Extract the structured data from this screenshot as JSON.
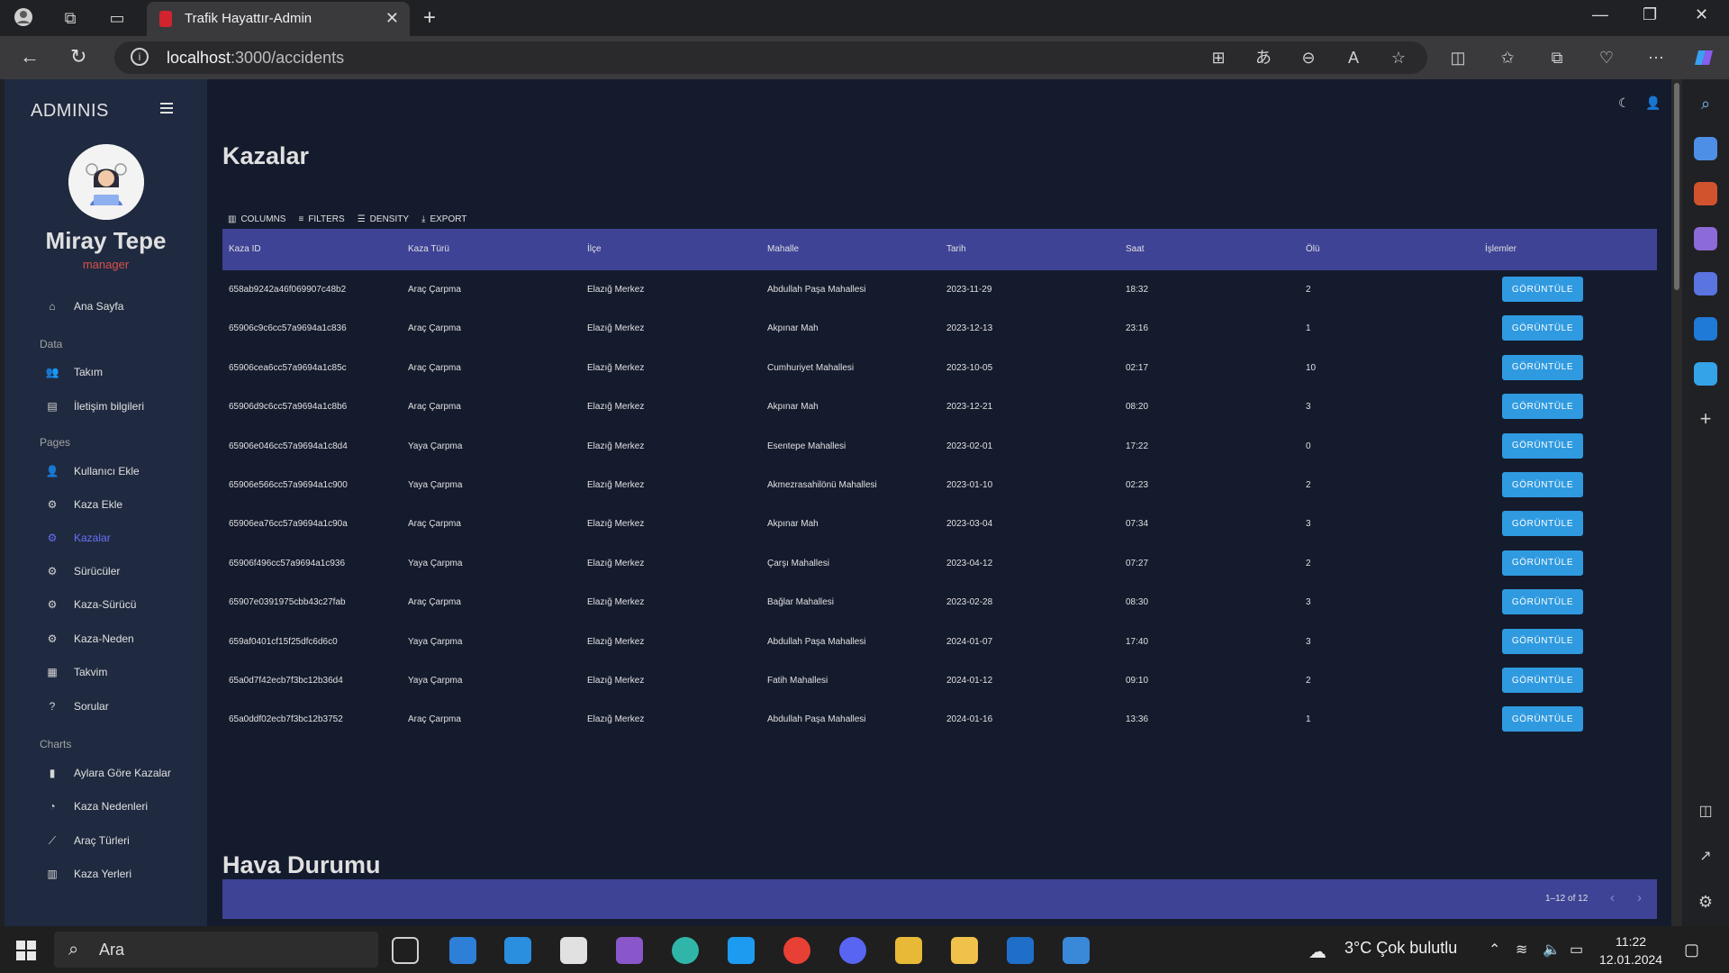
{
  "browser": {
    "tab_title": "Trafik Hayattır-Admin",
    "url_host": "localhost",
    "url_path": ":3000/accidents"
  },
  "sidebar": {
    "brand": "ADMINIS",
    "user_name": "Miray Tepe",
    "user_role": "manager",
    "home": "Ana Sayfa",
    "section_data": "Data",
    "data_items": [
      "Takım",
      "İletişim bilgileri"
    ],
    "section_pages": "Pages",
    "page_items": [
      "Kullanıcı Ekle",
      "Kaza Ekle",
      "Kazalar",
      "Sürücüler",
      "Kaza-Sürücü",
      "Kaza-Neden",
      "Takvim",
      "Sorular"
    ],
    "section_charts": "Charts",
    "chart_items": [
      "Aylara Göre Kazalar",
      "Kaza Nedenleri",
      "Araç Türleri",
      "Kaza Yerleri"
    ],
    "active_item": "Kazalar"
  },
  "main": {
    "title": "Kazalar",
    "toolbar": {
      "columns": "COLUMNS",
      "filters": "FILTERS",
      "density": "DENSITY",
      "export": "EXPORT"
    },
    "columns": [
      "Kaza ID",
      "Kaza Türü",
      "İlçe",
      "Mahalle",
      "Tarih",
      "Saat",
      "Ölü",
      "İşlemler"
    ],
    "action_label": "GÖRÜNTÜLE",
    "rows": [
      [
        "658ab9242a46f069907c48b2",
        "Araç Çarpma",
        "Elazığ Merkez",
        "Abdullah Paşa Mahallesi",
        "2023-11-29",
        "18:32",
        "2"
      ],
      [
        "65906c9c6cc57a9694a1c836",
        "Araç Çarpma",
        "Elazığ Merkez",
        "Akpınar Mah",
        "2023-12-13",
        "23:16",
        "1"
      ],
      [
        "65906cea6cc57a9694a1c85c",
        "Araç Çarpma",
        "Elazığ Merkez",
        "Cumhuriyet Mahallesi",
        "2023-10-05",
        "02:17",
        "10"
      ],
      [
        "65906d9c6cc57a9694a1c8b6",
        "Araç Çarpma",
        "Elazığ Merkez",
        "Akpınar Mah",
        "2023-12-21",
        "08:20",
        "3"
      ],
      [
        "65906e046cc57a9694a1c8d4",
        "Yaya Çarpma",
        "Elazığ Merkez",
        "Esentepe Mahallesi",
        "2023-02-01",
        "17:22",
        "0"
      ],
      [
        "65906e566cc57a9694a1c900",
        "Yaya Çarpma",
        "Elazığ Merkez",
        "Akmezrasahilönü Mahallesi",
        "2023-01-10",
        "02:23",
        "2"
      ],
      [
        "65906ea76cc57a9694a1c90a",
        "Araç Çarpma",
        "Elazığ Merkez",
        "Akpınar Mah",
        "2023-03-04",
        "07:34",
        "3"
      ],
      [
        "65906f496cc57a9694a1c936",
        "Yaya Çarpma",
        "Elazığ Merkez",
        "Çarşı Mahallesi",
        "2023-04-12",
        "07:27",
        "2"
      ],
      [
        "65907e0391975cbb43c27fab",
        "Araç Çarpma",
        "Elazığ Merkez",
        "Bağlar Mahallesi",
        "2023-02-28",
        "08:30",
        "3"
      ],
      [
        "659af0401cf15f25dfc6d6c0",
        "Yaya Çarpma",
        "Elazığ Merkez",
        "Abdullah Paşa Mahallesi",
        "2024-01-07",
        "17:40",
        "3"
      ],
      [
        "65a0d7f42ecb7f3bc12b36d4",
        "Yaya Çarpma",
        "Elazığ Merkez",
        "Fatih Mahallesi",
        "2024-01-12",
        "09:10",
        "2"
      ],
      [
        "65a0ddf02ecb7f3bc12b3752",
        "Araç Çarpma",
        "Elazığ Merkez",
        "Abdullah Paşa Mahallesi",
        "2024-01-16",
        "13:36",
        "1"
      ]
    ],
    "pagination": "1–12 of 12",
    "section2_title": "Hava Durumu"
  },
  "taskbar": {
    "search_placeholder": "Ara",
    "weather": "3°C  Çok bulutlu",
    "time": "11:22",
    "date": "12.01.2024"
  },
  "colors": {
    "sidebar_bg": "#1f2a40",
    "main_bg": "#141b2d",
    "grid_header": "#3e4396",
    "accent": "#6870fa",
    "button": "#2f9ae0",
    "role": "#db4f4a"
  }
}
